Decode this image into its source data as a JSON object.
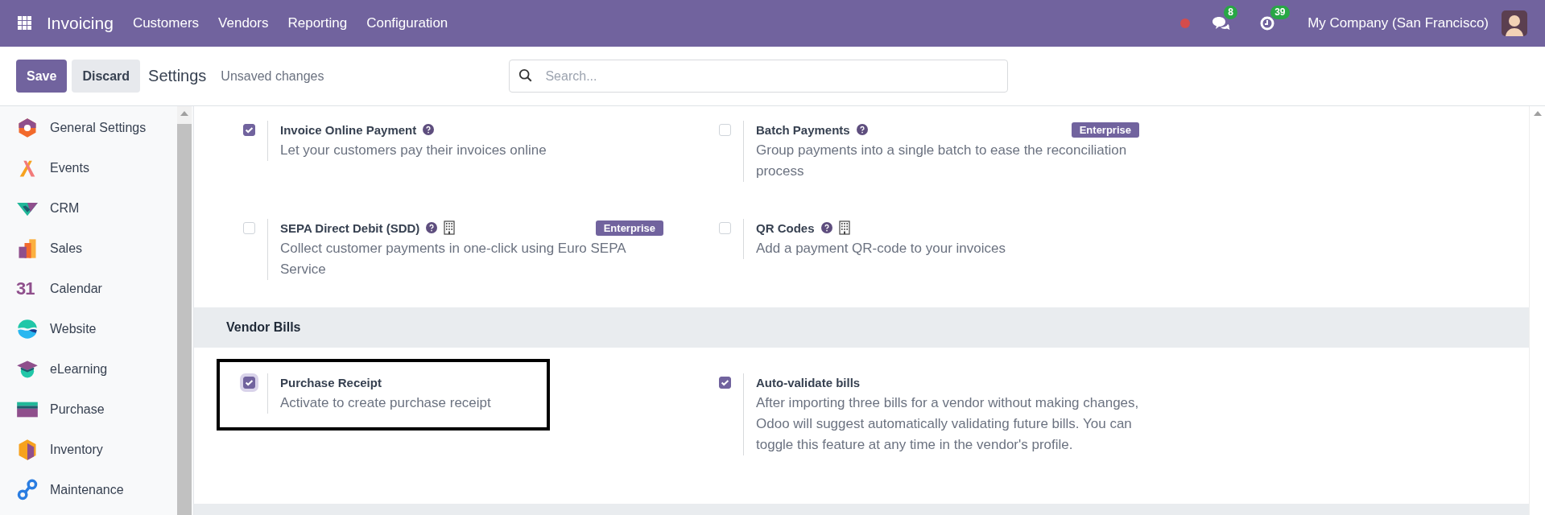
{
  "navbar": {
    "app_name": "Invoicing",
    "menu": [
      "Customers",
      "Vendors",
      "Reporting",
      "Configuration"
    ],
    "messages_count": "8",
    "activities_count": "39",
    "company": "My Company (San Francisco)"
  },
  "control_panel": {
    "save": "Save",
    "discard": "Discard",
    "title": "Settings",
    "status": "Unsaved changes",
    "search": {
      "placeholder": "Search..."
    }
  },
  "sidebar": {
    "items": [
      {
        "label": "General Settings",
        "kind": "general"
      },
      {
        "label": "Events",
        "kind": "events"
      },
      {
        "label": "CRM",
        "kind": "crm"
      },
      {
        "label": "Sales",
        "kind": "sales"
      },
      {
        "label": "Calendar",
        "kind": "calendar",
        "icon_text": "31"
      },
      {
        "label": "Website",
        "kind": "website"
      },
      {
        "label": "eLearning",
        "kind": "elearning"
      },
      {
        "label": "Purchase",
        "kind": "purchase"
      },
      {
        "label": "Inventory",
        "kind": "inventory"
      },
      {
        "label": "Maintenance",
        "kind": "maintenance"
      }
    ]
  },
  "sections": [
    {
      "settings": [
        {
          "title": "Invoice Online Payment",
          "description": "Let your customers pay their invoices online",
          "checked": true,
          "help": true,
          "building": false,
          "highlighted": false
        },
        {
          "title": "Batch Payments",
          "description": "Group payments into a single batch to ease the reconciliation process",
          "checked": false,
          "help": true,
          "building": false,
          "badge": "Enterprise",
          "highlighted": false
        },
        {
          "title": "SEPA Direct Debit (SDD)",
          "description": "Collect customer payments in one-click using Euro SEPA Service",
          "checked": false,
          "help": true,
          "building": true,
          "badge": "Enterprise",
          "highlighted": false
        },
        {
          "title": "QR Codes",
          "description": "Add a payment QR-code to your invoices",
          "checked": false,
          "help": true,
          "building": true,
          "highlighted": false
        }
      ]
    },
    {
      "title": "Vendor Bills",
      "settings": [
        {
          "title": "Purchase Receipt",
          "description": "Activate to create purchase receipt",
          "checked": true,
          "help": false,
          "building": false,
          "highlighted": true
        },
        {
          "title": "Auto-validate bills",
          "description": "After importing three bills for a vendor without making changes, Odoo will suggest automatically validating future bills. You can toggle this feature at any time in the vendor's profile.",
          "checked": true,
          "help": false,
          "building": false,
          "highlighted": false
        }
      ]
    }
  ]
}
